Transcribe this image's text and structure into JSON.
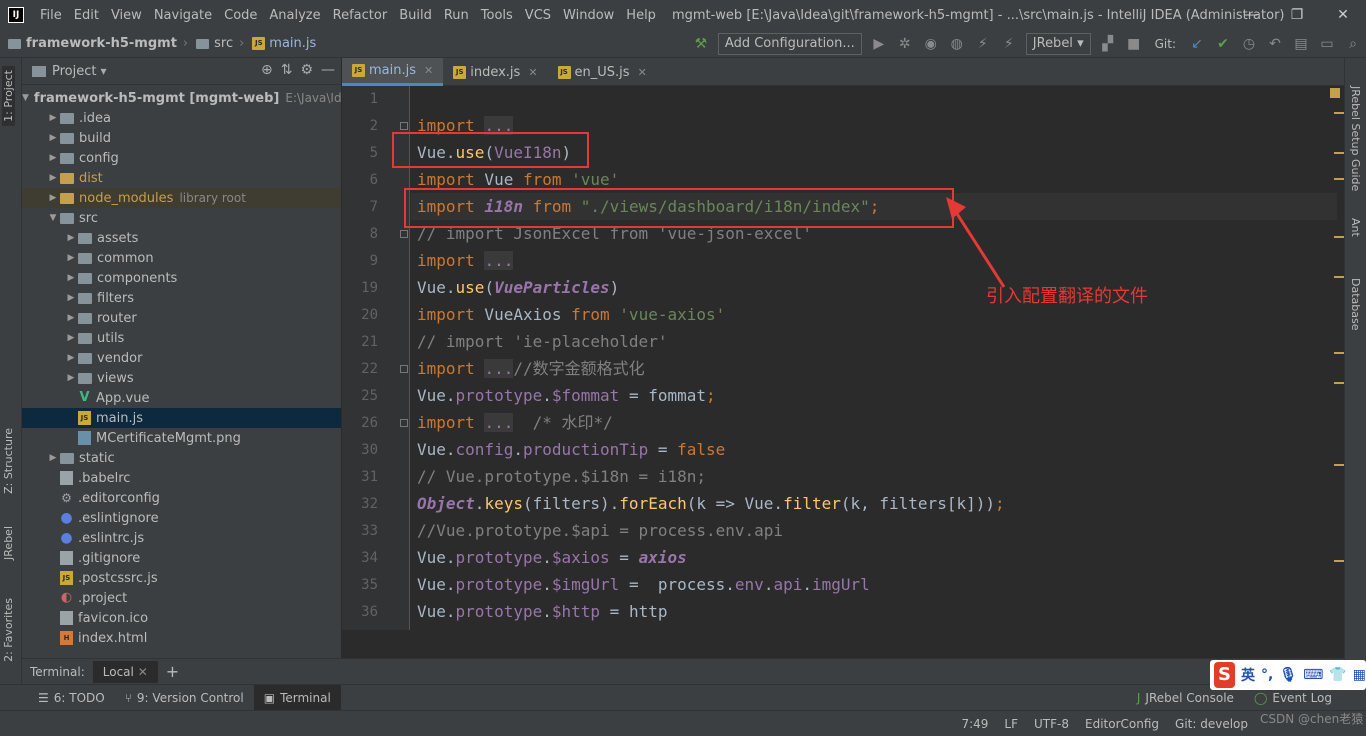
{
  "window": {
    "logo": "IJ",
    "title": "mgmt-web [E:\\Java\\Idea\\git\\framework-h5-mgmt] - ...\\src\\main.js - IntelliJ IDEA (Administrator)",
    "minimize": "—",
    "restore": "❐",
    "close": "✕"
  },
  "menu": [
    "File",
    "Edit",
    "View",
    "Navigate",
    "Code",
    "Analyze",
    "Refactor",
    "Build",
    "Run",
    "Tools",
    "VCS",
    "Window",
    "Help"
  ],
  "breadcrumb": {
    "project": "framework-h5-mgmt",
    "folder": "src",
    "file": "main.js"
  },
  "toolbar": {
    "add_config": "Add Configuration...",
    "jrebel": "JRebel",
    "git_label": "Git:"
  },
  "left_tabs": {
    "project": "1: Project",
    "structure": "Z: Structure",
    "jrebel": "JRebel",
    "favorites": "2: Favorites"
  },
  "right_tabs": {
    "jrebel_setup": "JRebel Setup Guide",
    "ant": "Ant",
    "database": "Database"
  },
  "project_panel": {
    "title": "Project",
    "tree": [
      {
        "label": "framework-h5-mgmt [mgmt-web]",
        "extra": "E:\\Java\\Idea",
        "kind": "folder",
        "depth": 0,
        "arrow": "▼",
        "bold": true
      },
      {
        "label": ".idea",
        "kind": "folder",
        "depth": 1,
        "arrow": "▶"
      },
      {
        "label": "build",
        "kind": "folder",
        "depth": 1,
        "arrow": "▶"
      },
      {
        "label": "config",
        "kind": "folder",
        "depth": 1,
        "arrow": "▶"
      },
      {
        "label": "dist",
        "kind": "folder-orange",
        "depth": 1,
        "arrow": "▶",
        "color": "#c59f4d"
      },
      {
        "label": "node_modules",
        "extra": "library root",
        "kind": "folder-orange",
        "depth": 1,
        "arrow": "▶",
        "color": "#c59f4d",
        "excluded": true
      },
      {
        "label": "src",
        "kind": "folder",
        "depth": 1,
        "arrow": "▼"
      },
      {
        "label": "assets",
        "kind": "folder",
        "depth": 2,
        "arrow": "▶"
      },
      {
        "label": "common",
        "kind": "folder",
        "depth": 2,
        "arrow": "▶"
      },
      {
        "label": "components",
        "kind": "folder",
        "depth": 2,
        "arrow": "▶"
      },
      {
        "label": "filters",
        "kind": "folder",
        "depth": 2,
        "arrow": "▶"
      },
      {
        "label": "router",
        "kind": "folder",
        "depth": 2,
        "arrow": "▶"
      },
      {
        "label": "utils",
        "kind": "folder",
        "depth": 2,
        "arrow": "▶"
      },
      {
        "label": "vendor",
        "kind": "folder",
        "depth": 2,
        "arrow": "▶"
      },
      {
        "label": "views",
        "kind": "folder",
        "depth": 2,
        "arrow": "▶"
      },
      {
        "label": "App.vue",
        "kind": "vue",
        "depth": 2,
        "arrow": ""
      },
      {
        "label": "main.js",
        "kind": "js",
        "depth": 2,
        "arrow": "",
        "selected": true
      },
      {
        "label": "MCertificateMgmt.png",
        "kind": "img",
        "depth": 2,
        "arrow": ""
      },
      {
        "label": "static",
        "kind": "folder",
        "depth": 1,
        "arrow": "▶"
      },
      {
        "label": ".babelrc",
        "kind": "file",
        "depth": 1,
        "arrow": ""
      },
      {
        "label": ".editorconfig",
        "kind": "gear",
        "depth": 1,
        "arrow": ""
      },
      {
        "label": ".eslintignore",
        "kind": "dot",
        "depth": 1,
        "arrow": ""
      },
      {
        "label": ".eslintrc.js",
        "kind": "dot",
        "depth": 1,
        "arrow": ""
      },
      {
        "label": ".gitignore",
        "kind": "file",
        "depth": 1,
        "arrow": ""
      },
      {
        "label": ".postcssrc.js",
        "kind": "js",
        "depth": 1,
        "arrow": ""
      },
      {
        "label": ".project",
        "kind": "proj",
        "depth": 1,
        "arrow": ""
      },
      {
        "label": "favicon.ico",
        "kind": "file",
        "depth": 1,
        "arrow": ""
      },
      {
        "label": "index.html",
        "kind": "html",
        "depth": 1,
        "arrow": ""
      }
    ]
  },
  "editor_tabs": [
    {
      "label": "main.js",
      "active": true
    },
    {
      "label": "index.js",
      "active": false
    },
    {
      "label": "en_US.js",
      "active": false
    }
  ],
  "line_numbers": [
    "1",
    "2",
    "5",
    "6",
    "7",
    "8",
    "9",
    "19",
    "20",
    "21",
    "22",
    "25",
    "26",
    "30",
    "31",
    "32",
    "33",
    "34",
    "35",
    "36"
  ],
  "annotation": "引入配置翻译的文件",
  "terminal": {
    "label": "Terminal:",
    "tab": "Local",
    "add": "+"
  },
  "bottom_tools": [
    {
      "label": "6: TODO",
      "icon": "☰"
    },
    {
      "label": "9: Version Control",
      "icon": "⑂"
    },
    {
      "label": "Terminal",
      "icon": "▣",
      "active": true
    }
  ],
  "bottom_right_tools": [
    {
      "label": "JRebel Console",
      "icon": "J"
    },
    {
      "label": "Event Log",
      "icon": "◯"
    }
  ],
  "status": {
    "position": "7:49",
    "line_sep": "LF",
    "encoding": "UTF-8",
    "editorconfig": "EditorConfig",
    "git": "Git: develop"
  },
  "ime": {
    "logo": "S",
    "lang": "英"
  },
  "watermark": "CSDN @chen老猿"
}
